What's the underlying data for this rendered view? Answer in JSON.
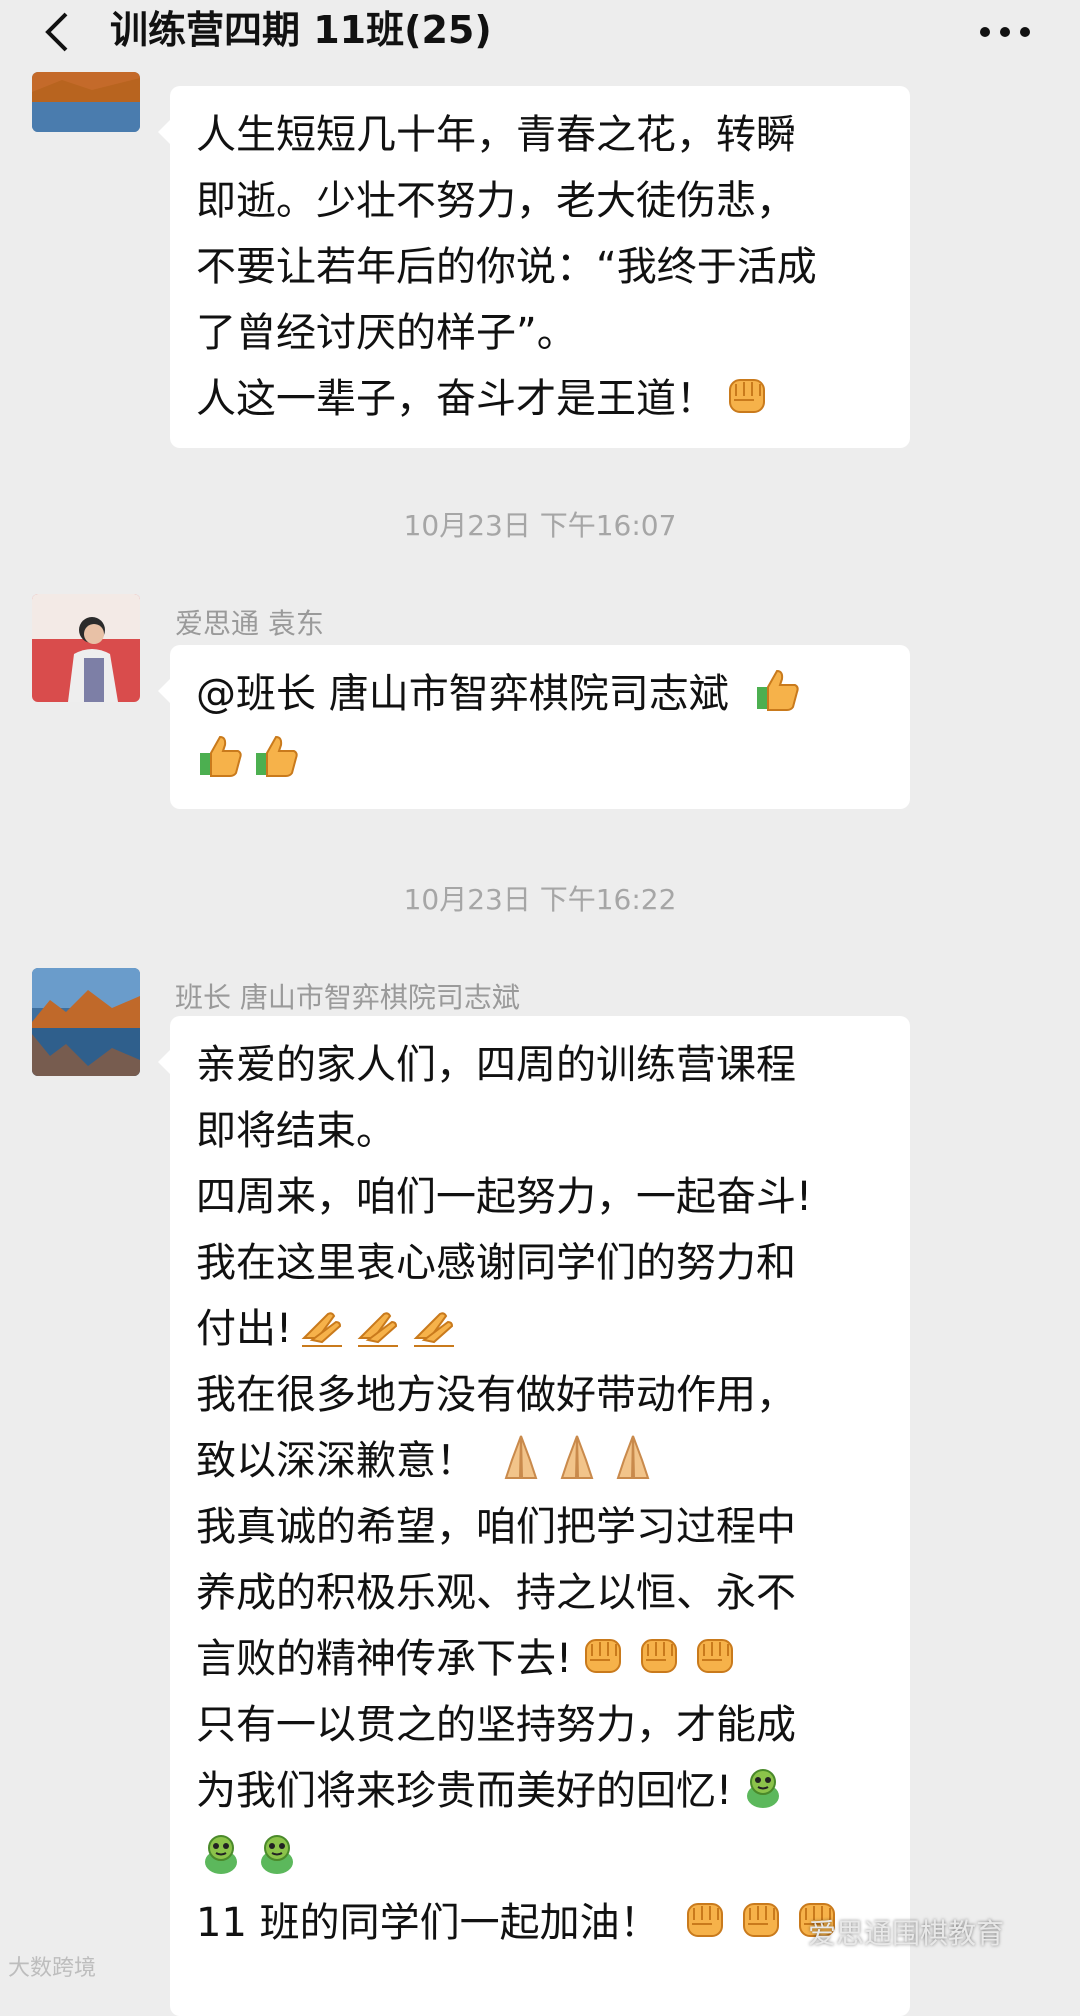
{
  "header": {
    "back_icon": "chevron-left-icon",
    "title": "训练营四期 11班(25)",
    "more_icon": "more-dots-icon"
  },
  "messages": [
    {
      "lines": [
        "人生短短几十年，青春之花，转瞬",
        "即逝。少壮不努力，老大徒伤悲，",
        "不要让若年后的你说：“我终于活成",
        "了曾经讨厌的样子”。",
        "人这一辈子，奋斗才是王道！"
      ],
      "emoji": [
        "fist-emoji"
      ]
    },
    {
      "timestamp": "10月23日 下午16:07",
      "sender": "爱思通 袁东",
      "lines": [
        "@班长 唐山市智弈棋院司志斌"
      ],
      "emoji": [
        "thumbs-up-emoji",
        "thumbs-up-emoji",
        "thumbs-up-emoji"
      ]
    },
    {
      "timestamp": "10月23日 下午16:22",
      "sender": "班长 唐山市智弈棋院司志斌",
      "lines": [
        "亲爱的家人们，四周的训练营课程",
        "即将结束。",
        "四周来，咱们一起努力，一起奋斗!",
        "我在这里衷心感谢同学们的努力和",
        "付出!",
        "我在很多地方没有做好带动作用，",
        "致以深深歉意！",
        "我真诚的希望，咱们把学习过程中",
        "养成的积极乐观、持之以恒、永不",
        "言败的精神传承下去!",
        "只有一以贯之的坚持努力，才能成",
        "为我们将来珍贵而美好的回忆!",
        "11 班的同学们一起加油！"
      ]
    }
  ],
  "watermarks": {
    "left": "大数跨境",
    "right": "爱思通围棋教育"
  },
  "colors": {
    "background": "#ededed",
    "bubble": "#ffffff",
    "meta_text": "#a6a6a6"
  }
}
